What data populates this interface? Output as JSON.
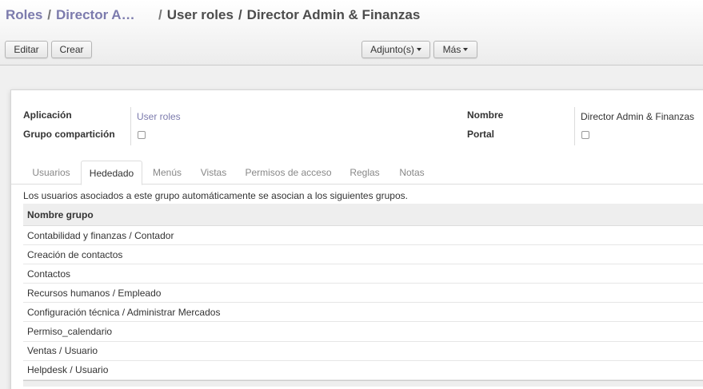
{
  "breadcrumb": {
    "items": [
      "Roles",
      "Director Admin & Finanzas",
      "User roles",
      "Director Admin & Finanzas"
    ],
    "separator": "/"
  },
  "toolbar": {
    "edit_label": "Editar",
    "create_label": "Crear",
    "attachments_label": "Adjunto(s)",
    "more_label": "Más"
  },
  "form": {
    "application_label": "Aplicación",
    "application_value": "User roles",
    "share_group_label": "Grupo compartición",
    "share_group_checked": false,
    "name_label": "Nombre",
    "name_value": "Director Admin & Finanzas",
    "portal_label": "Portal",
    "portal_checked": false
  },
  "tabs": [
    {
      "label": "Usuarios",
      "active": false
    },
    {
      "label": "Hededado",
      "active": true
    },
    {
      "label": "Menús",
      "active": false
    },
    {
      "label": "Vistas",
      "active": false
    },
    {
      "label": "Permisos de acceso",
      "active": false
    },
    {
      "label": "Reglas",
      "active": false
    },
    {
      "label": "Notas",
      "active": false
    }
  ],
  "inherited": {
    "description": "Los usuarios asociados a este grupo automáticamente se asocian a los siguientes grupos.",
    "column_header": "Nombre grupo",
    "rows": [
      "Contabilidad y finanzas / Contador",
      "Creación de contactos",
      "Contactos",
      "Recursos humanos / Empleado",
      "Configuración técnica / Administrar Mercados",
      "Permiso_calendario",
      "Ventas / Usuario",
      "Helpdesk / Usuario"
    ]
  },
  "colors": {
    "link": "#7c7bad",
    "text": "#333333",
    "header_bg": "#eeeeee"
  }
}
